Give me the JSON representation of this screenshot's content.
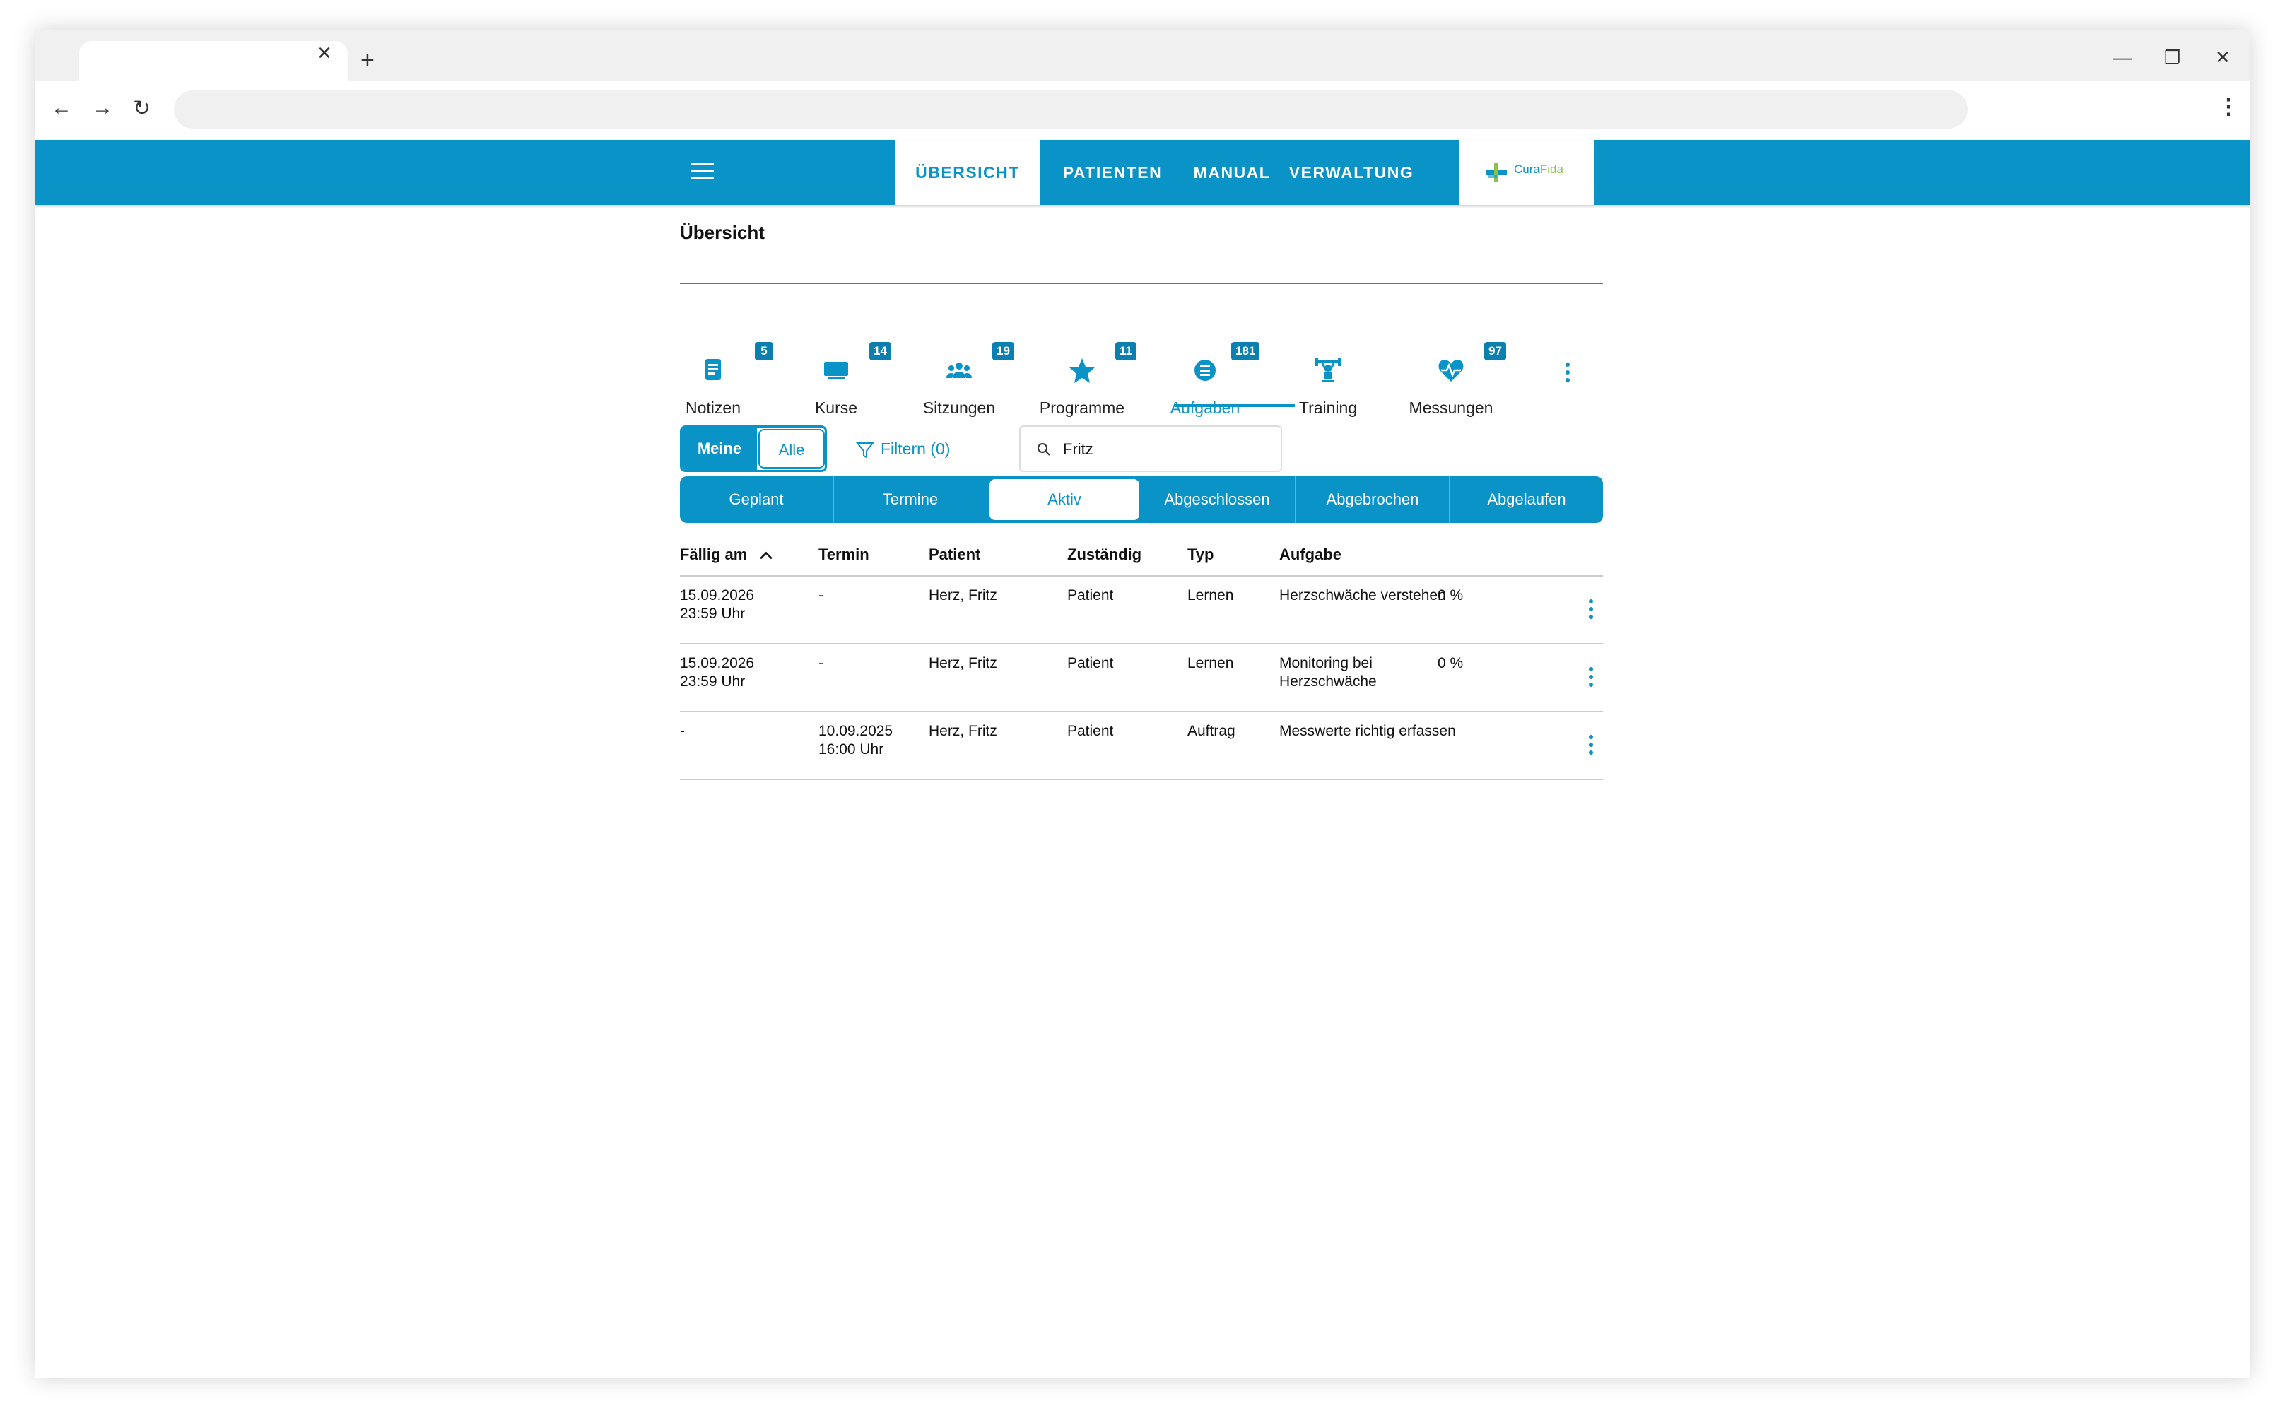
{
  "browser": {
    "tab_close": "✕",
    "new_tab": "+",
    "minimize": "—",
    "restore": "❐",
    "close": "✕",
    "back": "←",
    "forward": "→",
    "reload": "↻",
    "menu": "⋮"
  },
  "header": {
    "nav": [
      {
        "label": "ÜBERSICHT"
      },
      {
        "label": "PATIENTEN"
      },
      {
        "label": "MANUAL"
      },
      {
        "label": "VERWALTUNG"
      }
    ],
    "logo_text_a": "Cura",
    "logo_text_b": "Fida"
  },
  "page": {
    "title": "Übersicht"
  },
  "categories": [
    {
      "label": "Notizen",
      "badge": "5",
      "icon": "note-icon"
    },
    {
      "label": "Kurse",
      "badge": "14",
      "icon": "monitor-icon"
    },
    {
      "label": "Sitzungen",
      "badge": "19",
      "icon": "group-icon"
    },
    {
      "label": "Programme",
      "badge": "11",
      "icon": "star-icon"
    },
    {
      "label": "Aufgaben",
      "badge": "181",
      "icon": "list-icon"
    },
    {
      "label": "Training",
      "badge": "",
      "icon": "weightlifter-icon"
    },
    {
      "label": "Messungen",
      "badge": "97",
      "icon": "heartbeat-icon"
    }
  ],
  "filters": {
    "mine": "Meine",
    "all": "Alle",
    "filter_label": "Filtern (0)",
    "search_value": "Fritz"
  },
  "status_tabs": [
    {
      "label": "Geplant"
    },
    {
      "label": "Termine"
    },
    {
      "label": "Aktiv"
    },
    {
      "label": "Abgeschlossen"
    },
    {
      "label": "Abgebrochen"
    },
    {
      "label": "Abgelaufen"
    }
  ],
  "table": {
    "columns": [
      "Fällig am",
      "Termin",
      "Patient",
      "Zuständig",
      "Typ",
      "Aufgabe"
    ],
    "rows": [
      {
        "due1": "15.09.2026",
        "due2": "23:59 Uhr",
        "term1": "-",
        "term2": "",
        "patient": "Herz, Fritz",
        "resp": "Patient",
        "type": "Lernen",
        "task1": "Herzschwäche verstehen",
        "task2": "",
        "progress": "0 %"
      },
      {
        "due1": "15.09.2026",
        "due2": "23:59 Uhr",
        "term1": "-",
        "term2": "",
        "patient": "Herz, Fritz",
        "resp": "Patient",
        "type": "Lernen",
        "task1": "Monitoring bei",
        "task2": "Herzschwäche",
        "progress": "0 %"
      },
      {
        "due1": "-",
        "due2": "",
        "term1": "10.09.2025",
        "term2": "16:00 Uhr",
        "patient": "Herz, Fritz",
        "resp": "Patient",
        "type": "Auftrag",
        "task1": "Messwerte richtig erfassen",
        "task2": "",
        "progress": ""
      }
    ]
  },
  "colors": {
    "primary": "#0a93c6",
    "badge": "#0a7fb0"
  }
}
